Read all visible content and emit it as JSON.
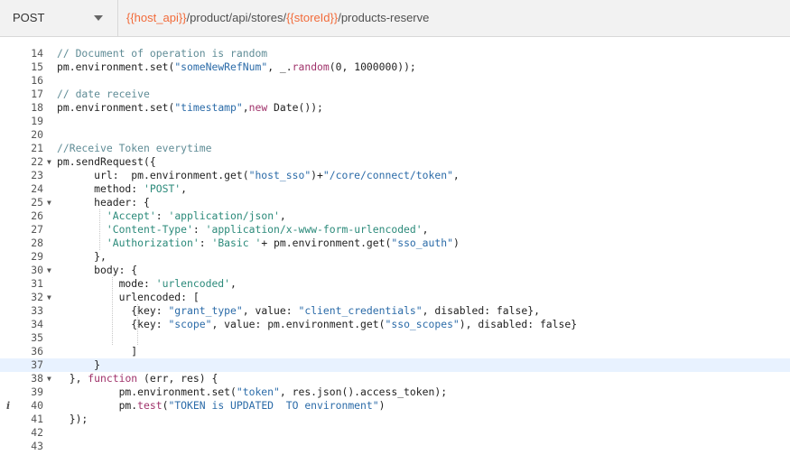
{
  "request": {
    "method": "POST",
    "url_parts": [
      {
        "text": "{{host_api}}",
        "var": true
      },
      {
        "text": "/product/api/stores/",
        "var": false
      },
      {
        "text": "{{storeId}}",
        "var": true
      },
      {
        "text": "/products-reserve",
        "var": false
      }
    ]
  },
  "editor": {
    "active_line": 37,
    "info_line": 40,
    "lines": [
      {
        "n": 14,
        "fold": false,
        "tokens": [
          [
            "com",
            "// Document of operation is random"
          ]
        ]
      },
      {
        "n": 15,
        "fold": false,
        "tokens": [
          [
            "plain",
            "pm.environment.set("
          ],
          [
            "str",
            "\"someNewRefNum\""
          ],
          [
            "plain",
            ", _."
          ],
          [
            "fn",
            "random"
          ],
          [
            "plain",
            "(0, 1000000));"
          ]
        ]
      },
      {
        "n": 16,
        "fold": false,
        "tokens": []
      },
      {
        "n": 17,
        "fold": false,
        "tokens": [
          [
            "com",
            "// date receive"
          ]
        ]
      },
      {
        "n": 18,
        "fold": false,
        "tokens": [
          [
            "plain",
            "pm.environment.set("
          ],
          [
            "str",
            "\"timestamp\""
          ],
          [
            "plain",
            ","
          ],
          [
            "kw",
            "new"
          ],
          [
            "plain",
            " Date());"
          ]
        ]
      },
      {
        "n": 19,
        "fold": false,
        "tokens": []
      },
      {
        "n": 20,
        "fold": false,
        "tokens": []
      },
      {
        "n": 21,
        "fold": false,
        "tokens": [
          [
            "com",
            "//Receive Token everytime"
          ]
        ]
      },
      {
        "n": 22,
        "fold": true,
        "tokens": [
          [
            "plain",
            "pm.sendRequest({"
          ]
        ]
      },
      {
        "n": 23,
        "fold": false,
        "tokens": [
          [
            "plain",
            "      url:  pm.environment.get("
          ],
          [
            "str",
            "\"host_sso\""
          ],
          [
            "plain",
            ")+"
          ],
          [
            "str",
            "\"/core/connect/token\""
          ],
          [
            "plain",
            ","
          ]
        ]
      },
      {
        "n": 24,
        "fold": false,
        "tokens": [
          [
            "plain",
            "      method: "
          ],
          [
            "sq",
            "'POST'"
          ],
          [
            "plain",
            ","
          ]
        ]
      },
      {
        "n": 25,
        "fold": true,
        "tokens": [
          [
            "plain",
            "      header: {"
          ]
        ]
      },
      {
        "n": 26,
        "fold": false,
        "tokens": [
          [
            "plain",
            "        "
          ],
          [
            "sq",
            "'Accept'"
          ],
          [
            "plain",
            ": "
          ],
          [
            "sq",
            "'application/json'"
          ],
          [
            "plain",
            ","
          ]
        ]
      },
      {
        "n": 27,
        "fold": false,
        "tokens": [
          [
            "plain",
            "        "
          ],
          [
            "sq",
            "'Content-Type'"
          ],
          [
            "plain",
            ": "
          ],
          [
            "sq",
            "'application/x-www-form-urlencoded'"
          ],
          [
            "plain",
            ","
          ]
        ]
      },
      {
        "n": 28,
        "fold": false,
        "tokens": [
          [
            "plain",
            "        "
          ],
          [
            "sq",
            "'Authorization'"
          ],
          [
            "plain",
            ": "
          ],
          [
            "sq",
            "'Basic '"
          ],
          [
            "plain",
            "+ pm.environment.get("
          ],
          [
            "str",
            "\"sso_auth\""
          ],
          [
            "plain",
            ")"
          ]
        ]
      },
      {
        "n": 29,
        "fold": false,
        "tokens": [
          [
            "plain",
            "      },"
          ]
        ]
      },
      {
        "n": 30,
        "fold": true,
        "tokens": [
          [
            "plain",
            "      body: {"
          ]
        ]
      },
      {
        "n": 31,
        "fold": false,
        "tokens": [
          [
            "plain",
            "          mode: "
          ],
          [
            "sq",
            "'urlencoded'"
          ],
          [
            "plain",
            ","
          ]
        ]
      },
      {
        "n": 32,
        "fold": true,
        "tokens": [
          [
            "plain",
            "          urlencoded: ["
          ]
        ]
      },
      {
        "n": 33,
        "fold": false,
        "tokens": [
          [
            "plain",
            "            {key: "
          ],
          [
            "str",
            "\"grant_type\""
          ],
          [
            "plain",
            ", value: "
          ],
          [
            "str",
            "\"client_credentials\""
          ],
          [
            "plain",
            ", disabled: false},"
          ]
        ]
      },
      {
        "n": 34,
        "fold": false,
        "tokens": [
          [
            "plain",
            "            {key: "
          ],
          [
            "str",
            "\"scope\""
          ],
          [
            "plain",
            ", value: pm.environment.get("
          ],
          [
            "str",
            "\"sso_scopes\""
          ],
          [
            "plain",
            "), disabled: false}"
          ]
        ]
      },
      {
        "n": 35,
        "fold": false,
        "tokens": []
      },
      {
        "n": 36,
        "fold": false,
        "tokens": [
          [
            "plain",
            "            ]"
          ]
        ]
      },
      {
        "n": 37,
        "fold": false,
        "tokens": [
          [
            "plain",
            "      }"
          ]
        ]
      },
      {
        "n": 38,
        "fold": true,
        "tokens": [
          [
            "plain",
            "  }, "
          ],
          [
            "kw",
            "function"
          ],
          [
            "plain",
            " (err, res) {"
          ]
        ]
      },
      {
        "n": 39,
        "fold": false,
        "tokens": [
          [
            "plain",
            "          pm.environment.set("
          ],
          [
            "str",
            "\"token\""
          ],
          [
            "plain",
            ", res.json().access_token);"
          ]
        ]
      },
      {
        "n": 40,
        "fold": false,
        "tokens": [
          [
            "plain",
            "          pm."
          ],
          [
            "fn",
            "test"
          ],
          [
            "plain",
            "("
          ],
          [
            "str",
            "\"TOKEN is UPDATED  TO environment\""
          ],
          [
            "plain",
            ")"
          ]
        ]
      },
      {
        "n": 41,
        "fold": false,
        "tokens": [
          [
            "plain",
            "  });"
          ]
        ]
      },
      {
        "n": 42,
        "fold": false,
        "tokens": []
      },
      {
        "n": 43,
        "fold": false,
        "tokens": []
      }
    ]
  }
}
